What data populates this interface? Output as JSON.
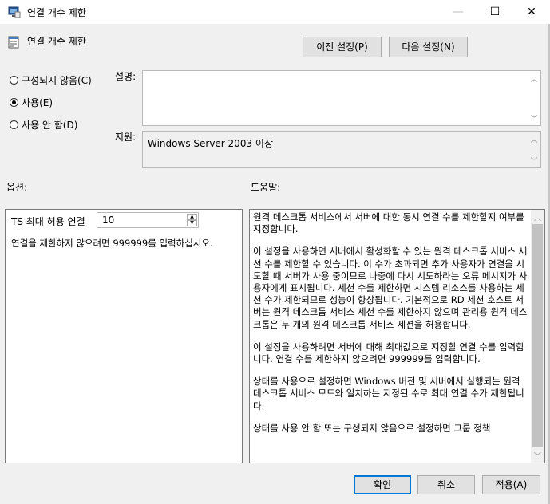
{
  "window": {
    "title": "연결 개수 제한",
    "controls": {
      "minimize": "—",
      "maximize": "☐",
      "close": "✕"
    }
  },
  "header": {
    "policy_name": "연결 개수 제한",
    "prev_button": "이전 설정(P)",
    "next_button": "다음 설정(N)"
  },
  "state": {
    "options": [
      {
        "label": "구성되지 않음(C)",
        "selected": false
      },
      {
        "label": "사용(E)",
        "selected": true
      },
      {
        "label": "사용 안 함(D)",
        "selected": false
      }
    ]
  },
  "comment": {
    "label": "설명:",
    "value": ""
  },
  "supported": {
    "label": "지원:",
    "value": "Windows Server 2003 이상"
  },
  "options_section": {
    "label": "옵션:",
    "max_connections_label": "TS 최대 허용 연결",
    "max_connections_value": "10",
    "note": "연결을 제한하지 않으려면 999999를 입력하십시오."
  },
  "help_section": {
    "label": "도움말:",
    "paragraphs": [
      "원격 데스크톱 서비스에서 서버에 대한 동시 연결 수를 제한할지 여부를 지정합니다.",
      "이 설정을 사용하면 서버에서 활성화할 수 있는 원격 데스크톱 서비스 세션 수를 제한할 수 있습니다. 이 수가 초과되면 추가 사용자가 연결을 시도할 때 서버가 사용 중이므로 나중에 다시 시도하라는 오류 메시지가 사용자에게 표시됩니다. 세션 수를 제한하면 시스템 리소스를 사용하는 세션 수가 제한되므로 성능이 향상됩니다. 기본적으로 RD 세션 호스트 서버는 원격 데스크톱 서비스 세션 수를 제한하지 않으며 관리용 원격 데스크톱은 두 개의 원격 데스크톱 서비스 세션을 허용합니다.",
      "이 설정을 사용하려면 서버에 대해 최대값으로 지정할 연결 수를 입력합니다. 연결 수를 제한하지 않으려면 999999를 입력합니다.",
      "상태를 사용으로 설정하면 Windows 버전 및 서버에서 실행되는 원격 데스크톱 서비스 모드와 일치하는 지정된 수로 최대 연결 수가 제한됩니다.",
      "상태를 사용 안 함 또는 구성되지 않음으로 설정하면 그룹 정책"
    ]
  },
  "footer": {
    "ok": "확인",
    "cancel": "취소",
    "apply": "적용(A)"
  }
}
